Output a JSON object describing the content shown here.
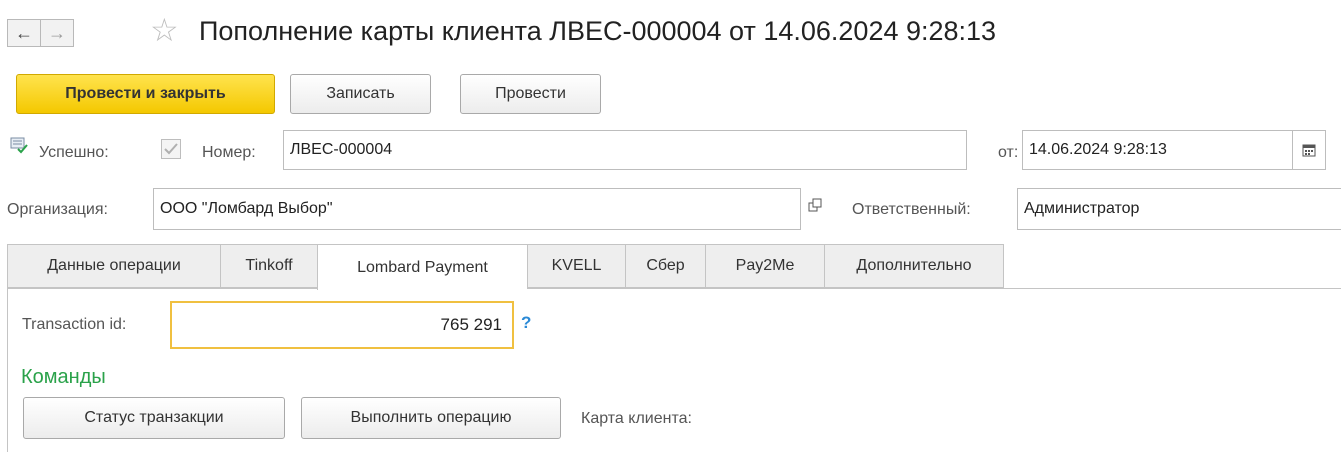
{
  "window": {
    "title": "Пополнение карты клиента ЛВЕС-000004 от 14.06.2024 9:28:13",
    "nav_back_icon": "←",
    "nav_forward_icon": "→",
    "favorite_icon": "☆"
  },
  "toolbar": {
    "post_close_label": "Провести и закрыть",
    "save_label": "Записать",
    "post_label": "Провести"
  },
  "header": {
    "status_icon": "🗊",
    "success_label": "Успешно:",
    "success_checked": true,
    "number_label": "Номер:",
    "number_value": "ЛВЕС-000004",
    "date_label": "от:",
    "date_value": "14.06.2024  9:28:13",
    "org_label": "Организация:",
    "org_value": "ООО \"Ломбард Выбор\"",
    "responsible_label": "Ответственный:",
    "responsible_value": "Администратор"
  },
  "tabs": [
    {
      "label": "Данные операции"
    },
    {
      "label": "Tinkoff"
    },
    {
      "label": "Lombard Payment"
    },
    {
      "label": "KVELL"
    },
    {
      "label": "Сбер"
    },
    {
      "label": "Pay2Me"
    },
    {
      "label": "Дополнительно"
    }
  ],
  "active_tab": "Lombard Payment",
  "panel": {
    "transaction_label": "Transaction id:",
    "transaction_value": "765 291",
    "help_text": "?",
    "commands_title": "Команды",
    "status_button": "Статус транзакции",
    "execute_button": "Выполнить операцию",
    "card_label": "Карта клиента:"
  },
  "colors": {
    "primary_button": "#f4c800",
    "section_title": "#2aa24a",
    "focus_border": "#f0c040",
    "help": "#2b8ad6"
  }
}
